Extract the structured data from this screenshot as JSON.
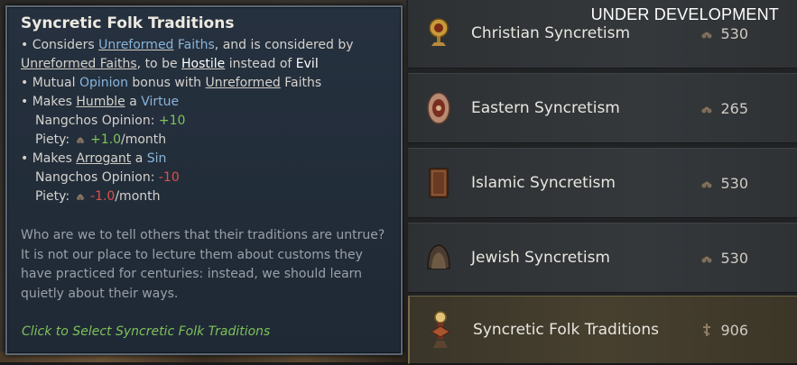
{
  "overlay": {
    "under_development": "UNDER DEVELOPMENT"
  },
  "tooltip": {
    "title": "Syncretic Folk Traditions",
    "l1_a": "Considers ",
    "l1_link": "Unreformed",
    "l1_b": " Faiths",
    "l1_c": ", and is considered by",
    "l2_link": "Unreformed Faiths",
    "l2_a": ", to be ",
    "l2_hostile": "Hostile",
    "l2_b": " instead of ",
    "l2_evil": "Evil",
    "l3_a": "Mutual ",
    "l3_opinion": "Opinion",
    "l3_b": " bonus with ",
    "l3_link": "Unreformed",
    "l3_c": " Faiths",
    "l4_a": "Makes ",
    "l4_link": "Humble",
    "l4_b": " a ",
    "l4_virtue": "Virtue",
    "l5_label": "Nangchos Opinion: ",
    "l5_val": "+10",
    "l6_label": "Piety: ",
    "l6_val": "+1.0",
    "l6_unit": "/month",
    "l7_a": "Makes ",
    "l7_link": "Arrogant",
    "l7_b": " a ",
    "l7_sin": "Sin",
    "l8_label": "Nangchos Opinion: ",
    "l8_val": "-10",
    "l9_label": "Piety: ",
    "l9_val": "-1.0",
    "l9_unit": "/month",
    "flavor": "Who are we to tell others that their traditions are untrue? It is not our place to lecture them about customs they have practiced for centuries: instead, we should learn quietly about their ways.",
    "click_hint": "Click to Select Syncretic Folk Traditions",
    "bullet": "•"
  },
  "list": {
    "items": [
      {
        "label": "Christian Syncretism",
        "cost": "530",
        "icon": "chalice-icon"
      },
      {
        "label": "Eastern Syncretism",
        "cost": "265",
        "icon": "wheel-icon"
      },
      {
        "label": "Islamic Syncretism",
        "cost": "530",
        "icon": "book-icon"
      },
      {
        "label": "Jewish Syncretism",
        "cost": "530",
        "icon": "helmet-icon"
      },
      {
        "label": "Syncretic Folk Traditions",
        "cost": "906",
        "icon": "totem-icon"
      }
    ]
  },
  "colors": {
    "accent_blue": "#8ab4d8",
    "positive": "#7fc45a",
    "negative": "#e0504a",
    "selected_bg": "#47402f"
  }
}
